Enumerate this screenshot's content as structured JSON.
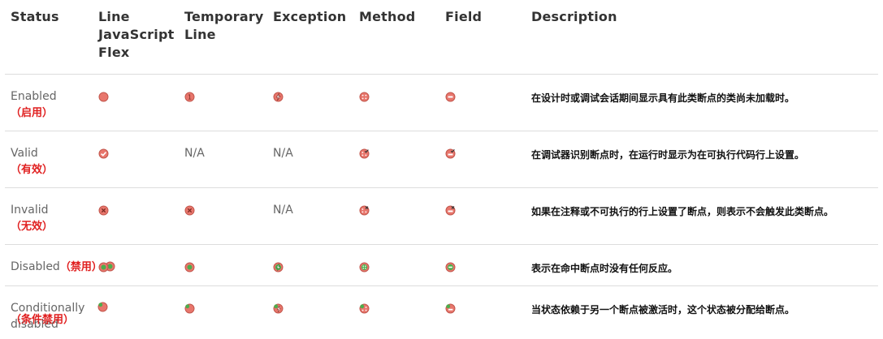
{
  "headers": {
    "status": "Status",
    "line": "Line JavaScript Flex",
    "temporary_line": "Temporary Line",
    "exception": "Exception",
    "method": "Method",
    "field": "Field",
    "description": "Description"
  },
  "rows": [
    {
      "status_en": "Enabled",
      "status_zh": "（启用）",
      "line_icon": "enabled-line-icon",
      "temporary_icon": "enabled-temporary-line-icon",
      "exception_icon": "enabled-exception-icon",
      "method_icon": "enabled-method-icon",
      "field_icon": "enabled-field-icon",
      "description": "在设计时或调试会话期间显示具有此类断点的类尚未加载时。"
    },
    {
      "status_en": "Valid",
      "status_zh": "（有效）",
      "line_icon": "valid-line-icon",
      "temporary_text": "N/A",
      "exception_text": "N/A",
      "method_icon": "valid-method-icon",
      "field_icon": "valid-field-icon",
      "description": "在调试器识别断点时，在运行时显示为在可执行代码行上设置。"
    },
    {
      "status_en": "Invalid",
      "status_zh": "（无效）",
      "line_icon": "invalid-line-icon",
      "temporary_icon": "invalid-temporary-line-icon",
      "exception_text": "N/A",
      "method_icon": "invalid-method-icon",
      "field_icon": "invalid-field-icon",
      "description": "如果在注释或不可执行的行上设置了断点，则表示不会触发此类断点。"
    },
    {
      "status_en": "Disabled",
      "status_zh": "（禁用）",
      "line_icon": "disabled-line-icon",
      "temporary_icon": "disabled-temporary-line-icon",
      "exception_icon": "disabled-exception-icon",
      "method_icon": "disabled-method-icon",
      "field_icon": "disabled-field-icon",
      "description": "表示在命中断点时没有任何反应。"
    },
    {
      "status_en": "Conditionally disabled",
      "status_zh": "（条件禁用）",
      "line_icon": "conditionally-disabled-line-icon",
      "temporary_icon": "conditionally-disabled-temporary-line-icon",
      "exception_icon": "conditionally-disabled-exception-icon",
      "method_icon": "conditionally-disabled-method-icon",
      "field_icon": "conditionally-disabled-field-icon",
      "description": "当状态依赖于另一个断点被激活时，这个状态被分配给断点。"
    }
  ],
  "colors": {
    "breakpoint_red": "#e8766c",
    "breakpoint_red_border": "#c2574d",
    "disabled_green": "#4cae4c",
    "status_zh_red": "#e01f1f",
    "divider": "#dddddd"
  }
}
